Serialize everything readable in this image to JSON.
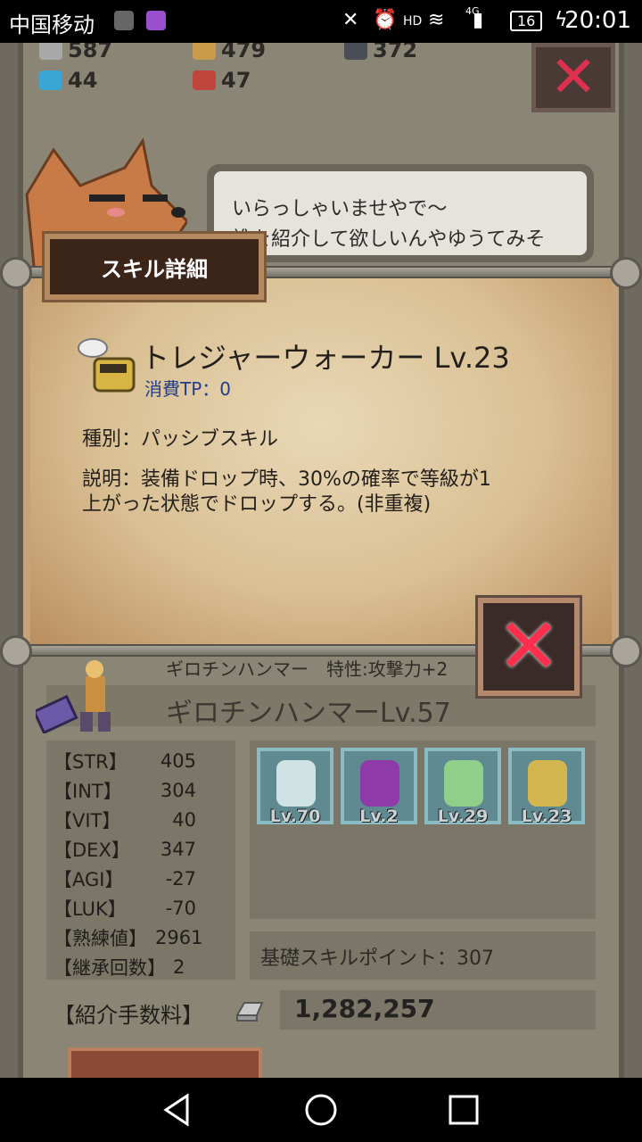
{
  "status_bar": {
    "carrier": "中国移动",
    "network": "4G",
    "hd": "HD",
    "battery": "16",
    "time": "20:01"
  },
  "resources": {
    "silver": "587",
    "bread": "479",
    "ore": "372",
    "blue_gem": "44",
    "red_gem": "47"
  },
  "npc": {
    "speech_line1": "いらっしゃいませやで〜",
    "speech_line2": "誰を紹介して欲しいんやゆうてみそ"
  },
  "skill_modal": {
    "title": "スキル詳細",
    "skill_name": "トレジャーウォーカー Lv.23",
    "tp_cost": "消費TP：0",
    "type": "種別：パッシブスキル",
    "description_line1": "説明：装備ドロップ時、30%の確率で等級が1",
    "description_line2": "上がった状態でドロップする。(非重複)"
  },
  "character": {
    "trait_line": "ギロチンハンマー　特性:攻撃力+2",
    "name": "ギロチンハンマーLv.57",
    "stats": [
      {
        "key": "【STR】",
        "value": "405"
      },
      {
        "key": "【INT】",
        "value": "304"
      },
      {
        "key": "【VIT】",
        "value": "40"
      },
      {
        "key": "【DEX】",
        "value": "347"
      },
      {
        "key": "【AGI】",
        "value": "-27"
      },
      {
        "key": "【LUK】",
        "value": "-70"
      }
    ],
    "proficiency_label": "【熟練値】",
    "proficiency_value": "2961",
    "inherit_label": "【継承回数】",
    "inherit_value": "2",
    "skills": [
      {
        "name": "HIT",
        "level": "Lv.70",
        "color": "#cfe3e4"
      },
      {
        "name": "AVD%",
        "level": "Lv.2",
        "color": "#8e3aa8"
      },
      {
        "name": "",
        "level": "Lv.29",
        "color": "#8fcf8a"
      },
      {
        "name": "",
        "level": "Lv.23",
        "color": "#d4b650"
      }
    ],
    "base_skill_points": "基礎スキルポイント：307"
  },
  "fee": {
    "label": "【紹介手数料】",
    "value": "1,282,257"
  },
  "colors": {
    "close_red": "#ff2e4d",
    "parchment": "#e2cfa8",
    "panel_dark": "#7b7667"
  }
}
